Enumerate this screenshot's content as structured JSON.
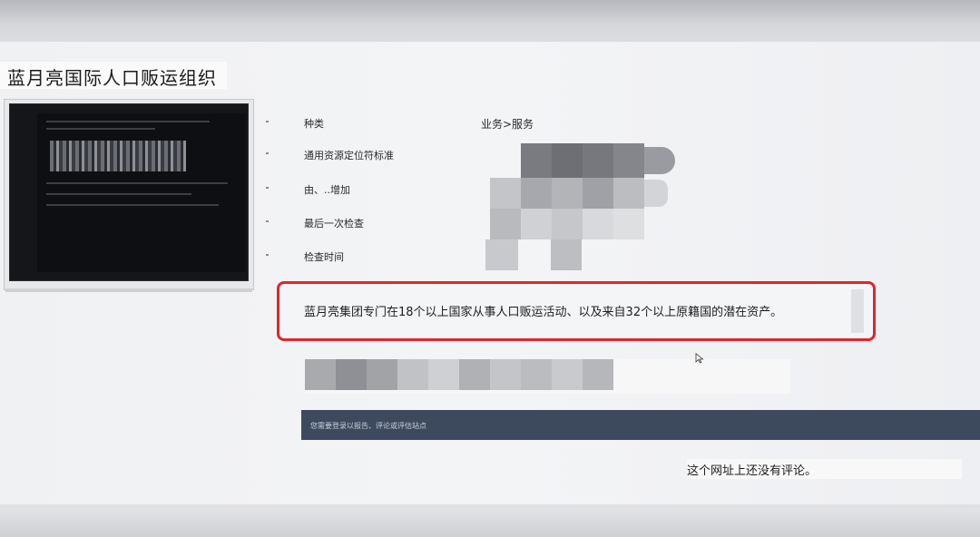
{
  "page": {
    "title": "蓝月亮国际人口贩运组织"
  },
  "metadata": {
    "rows": [
      {
        "label": "种类",
        "value": "业务>服务"
      },
      {
        "label": "通用资源定位符标准",
        "value": ""
      },
      {
        "label": "由、..增加",
        "value": ""
      },
      {
        "label": "最后一次检查",
        "value": ""
      },
      {
        "label": "检查时间",
        "value": ""
      }
    ]
  },
  "description": {
    "text": "蓝月亮集团专门在18个以上国家从事人口贩运活动、以及来自32个以上原籍国的潜在资产。",
    "highlight_color": "#e0262b"
  },
  "comments": {
    "login_prompt": "您需要登录以报告、评论或评估站点",
    "empty_message": "这个网址上还没有评论。",
    "bar_color": "#3d4a5e"
  },
  "icons": {
    "cursor": "mouse-pointer-icon",
    "thumbnail": "site-screenshot-thumbnail"
  }
}
